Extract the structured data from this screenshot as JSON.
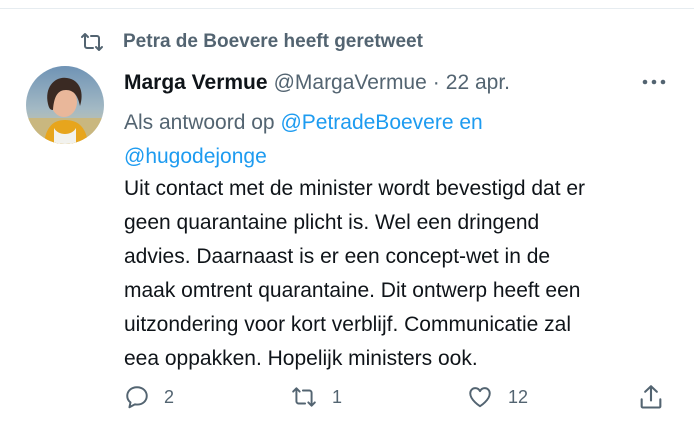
{
  "retweet_context": {
    "icon": "retweet-icon",
    "text": "Petra de Boevere heeft geretweet"
  },
  "tweet": {
    "avatar": "avatar",
    "display_name": "Marga Vermue",
    "handle": "@MargaVermue",
    "separator": "·",
    "date": "22 apr.",
    "more_icon": "more-icon",
    "reply_context": {
      "prefix": "Als antwoord op ",
      "mention_1": "@PetradeBoevere",
      "joiner": " en",
      "mention_2": "@hugodejonge"
    },
    "text_lines": [
      "Uit contact met de minister wordt bevestigd dat er",
      "geen quarantaine plicht is. Wel een dringend",
      "advies. Daarnaast is er een concept-wet in de",
      "maak omtrent quarantaine. Dit ontwerp heeft een",
      "uitzondering voor kort verblijf. Communicatie zal",
      "eea oppakken. Hopelijk ministers ook."
    ]
  },
  "actions": {
    "reply": {
      "icon": "reply-icon",
      "count": "2"
    },
    "retweet": {
      "icon": "retweet-icon",
      "count": "1"
    },
    "like": {
      "icon": "heart-icon",
      "count": "12"
    },
    "share": {
      "icon": "share-icon"
    }
  },
  "colors": {
    "text": "#0f1419",
    "secondary": "#536471",
    "accent": "#1d9bf0",
    "border": "#e6ecf0"
  }
}
